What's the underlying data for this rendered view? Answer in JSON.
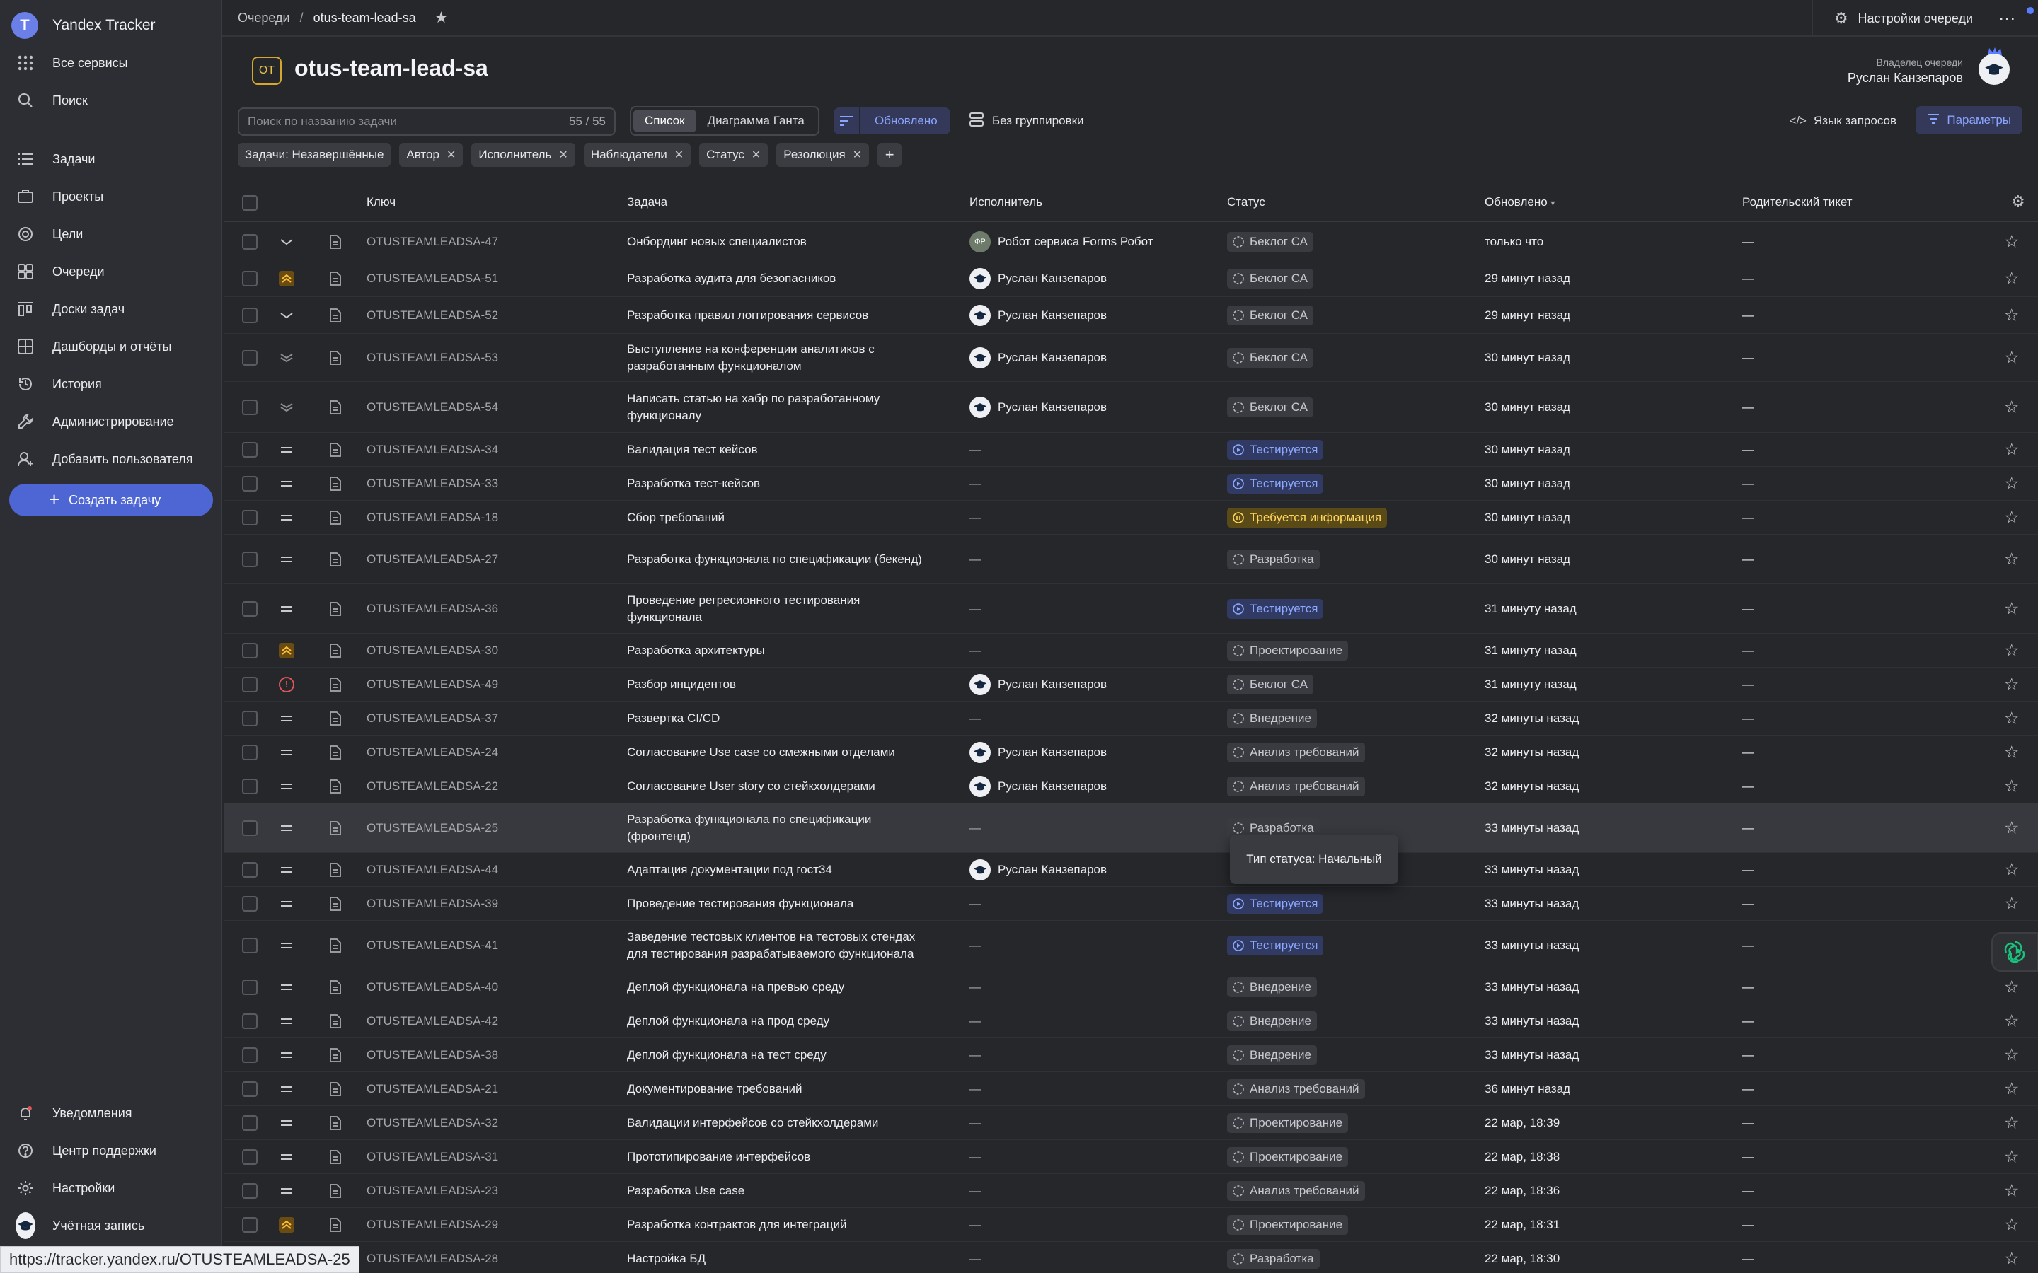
{
  "app": {
    "name": "Yandex Tracker",
    "logo_letter": "T"
  },
  "sidebar": {
    "top_items": [
      {
        "label": "Все сервисы",
        "icon": "grid-icon"
      },
      {
        "label": "Поиск",
        "icon": "search-icon"
      }
    ],
    "items": [
      {
        "label": "Задачи",
        "icon": "tasks-icon"
      },
      {
        "label": "Проекты",
        "icon": "projects-icon"
      },
      {
        "label": "Цели",
        "icon": "goals-icon"
      },
      {
        "label": "Очереди",
        "icon": "queues-icon"
      },
      {
        "label": "Доски задач",
        "icon": "boards-icon"
      },
      {
        "label": "Дашборды и отчёты",
        "icon": "dashboards-icon"
      },
      {
        "label": "История",
        "icon": "history-icon"
      },
      {
        "label": "Администрирование",
        "icon": "admin-icon"
      },
      {
        "label": "Добавить пользователя",
        "icon": "add-user-icon"
      }
    ],
    "create_label": "Создать задачу",
    "bottom_items": [
      {
        "label": "Уведомления",
        "icon": "bell-icon"
      },
      {
        "label": "Центр поддержки",
        "icon": "help-icon"
      },
      {
        "label": "Настройки",
        "icon": "gear-icon"
      },
      {
        "label": "Учётная запись",
        "icon": "account-avatar"
      }
    ]
  },
  "topbar": {
    "breadcrumb_root": "Очереди",
    "breadcrumb_sep": "/",
    "breadcrumb_current": "otus-team-lead-sa",
    "queue_settings_label": "Настройки очереди",
    "more_label": "⋯"
  },
  "header": {
    "badge": "OT",
    "title": "otus-team-lead-sa",
    "owner_caption": "Владелец очереди",
    "owner_name": "Руслан Канзепаров"
  },
  "toolbar": {
    "search_placeholder": "Поиск по названию задачи",
    "search_count": "55 / 55",
    "view_list": "Список",
    "view_gantt": "Диаграмма Ганта",
    "sort_label": "Обновлено",
    "group_label": "Без группировки",
    "query_label": "Язык запросов",
    "params_label": "Параметры"
  },
  "filters": [
    "Задачи: Незавершённые",
    "Автор",
    "Исполнитель",
    "Наблюдатели",
    "Статус",
    "Резолюция"
  ],
  "filters_closable": [
    false,
    true,
    true,
    true,
    true,
    true
  ],
  "table": {
    "headers": {
      "key": "Ключ",
      "task": "Задача",
      "assignee": "Исполнитель",
      "status": "Статус",
      "updated": "Обновлено",
      "parent": "Родительский тикет"
    },
    "rows": [
      {
        "prio": "low",
        "key": "OTUSTEAMLEADSA-47",
        "task": "Онбординг новых специалистов",
        "assignee": "Робот сервиса Forms Робот",
        "avatar": "robot",
        "status": "Беклог СА",
        "st": "gray",
        "updated": "только что",
        "parent": "—",
        "h": 52
      },
      {
        "prio": "high",
        "key": "OTUSTEAMLEADSA-51",
        "task": "Разработка аудита для безопасников",
        "assignee": "Руслан Канзепаров",
        "avatar": "cap",
        "status": "Беклог СА",
        "st": "gray",
        "updated": "29 минут назад",
        "parent": "—",
        "h": 52
      },
      {
        "prio": "low",
        "key": "OTUSTEAMLEADSA-52",
        "task": "Разработка правил логгирования сервисов",
        "assignee": "Руслан Канзепаров",
        "avatar": "cap",
        "status": "Беклог СА",
        "st": "gray",
        "updated": "29 минут назад",
        "parent": "—",
        "h": 52
      },
      {
        "prio": "lowest",
        "key": "OTUSTEAMLEADSA-53",
        "task": "Выступление на конференции аналитиков с разработанным функционалом",
        "assignee": "Руслан Канзепаров",
        "avatar": "cap",
        "status": "Беклог СА",
        "st": "gray",
        "updated": "30 минут назад",
        "parent": "—",
        "h": 68
      },
      {
        "prio": "lowest",
        "key": "OTUSTEAMLEADSA-54",
        "task": "Написать статью на хабр по разработанному функционалу",
        "assignee": "Руслан Канзепаров",
        "avatar": "cap",
        "status": "Беклог СА",
        "st": "gray",
        "updated": "30 минут назад",
        "parent": "—",
        "h": 72
      },
      {
        "prio": "normal",
        "key": "OTUSTEAMLEADSA-34",
        "task": "Валидация тест кейсов",
        "assignee": "—",
        "avatar": "",
        "status": "Тестируется",
        "st": "blue",
        "updated": "30 минут назад",
        "parent": "—",
        "h": 48
      },
      {
        "prio": "normal",
        "key": "OTUSTEAMLEADSA-33",
        "task": "Разработка тест-кейсов",
        "assignee": "—",
        "avatar": "",
        "status": "Тестируется",
        "st": "blue",
        "updated": "30 минут назад",
        "parent": "—",
        "h": 48
      },
      {
        "prio": "normal",
        "key": "OTUSTEAMLEADSA-18",
        "task": "Сбор требований",
        "assignee": "—",
        "avatar": "",
        "status": "Требуется информация",
        "st": "yellow",
        "updated": "30 минут назад",
        "parent": "—",
        "h": 48
      },
      {
        "prio": "normal",
        "key": "OTUSTEAMLEADSA-27",
        "task": "Разработка функционала по спецификации (бекенд)",
        "assignee": "—",
        "avatar": "",
        "status": "Разработка",
        "st": "gray",
        "updated": "30 минут назад",
        "parent": "—",
        "h": 70
      },
      {
        "prio": "normal",
        "key": "OTUSTEAMLEADSA-36",
        "task": "Проведение регресионного тестирования функционала",
        "assignee": "—",
        "avatar": "",
        "status": "Тестируется",
        "st": "blue",
        "updated": "31 минуту назад",
        "parent": "—",
        "h": 70
      },
      {
        "prio": "high",
        "key": "OTUSTEAMLEADSA-30",
        "task": "Разработка архитектуры",
        "assignee": "—",
        "avatar": "",
        "status": "Проектирование",
        "st": "gray",
        "updated": "31 минуту назад",
        "parent": "—",
        "h": 48
      },
      {
        "prio": "critical",
        "key": "OTUSTEAMLEADSA-49",
        "task": "Разбор инцидентов",
        "assignee": "Руслан Канзепаров",
        "avatar": "cap",
        "status": "Беклог СА",
        "st": "gray",
        "updated": "31 минуту назад",
        "parent": "—",
        "h": 48
      },
      {
        "prio": "normal",
        "key": "OTUSTEAMLEADSA-37",
        "task": "Развертка CI/CD",
        "assignee": "—",
        "avatar": "",
        "status": "Внедрение",
        "st": "gray",
        "updated": "32 минуты назад",
        "parent": "—",
        "h": 48
      },
      {
        "prio": "normal",
        "key": "OTUSTEAMLEADSA-24",
        "task": "Согласование Use case со смежными отделами",
        "assignee": "Руслан Канзепаров",
        "avatar": "cap",
        "status": "Анализ требований",
        "st": "gray",
        "updated": "32 минуты назад",
        "parent": "—",
        "h": 48
      },
      {
        "prio": "normal",
        "key": "OTUSTEAMLEADSA-22",
        "task": "Согласование User story со стейкхолдерами",
        "assignee": "Руслан Канзепаров",
        "avatar": "cap",
        "status": "Анализ требований",
        "st": "gray",
        "updated": "32 минуты назад",
        "parent": "—",
        "h": 48
      },
      {
        "prio": "normal",
        "key": "OTUSTEAMLEADSA-25",
        "task": "Разработка функционала по спецификации (фронтенд)",
        "assignee": "—",
        "avatar": "",
        "status": "Разработка",
        "st": "gray",
        "updated": "33 минуты назад",
        "parent": "—",
        "h": 70,
        "hl": true
      },
      {
        "prio": "normal",
        "key": "OTUSTEAMLEADSA-44",
        "task": "Адаптация документации под гост34",
        "assignee": "Руслан Канзепаров",
        "avatar": "cap",
        "status": "",
        "st": "gray",
        "updated": "33 минуты назад",
        "parent": "—",
        "h": 48
      },
      {
        "prio": "normal",
        "key": "OTUSTEAMLEADSA-39",
        "task": "Проведение тестирования функционала",
        "assignee": "—",
        "avatar": "",
        "status": "Тестируется",
        "st": "blue",
        "updated": "33 минуты назад",
        "parent": "—",
        "h": 48
      },
      {
        "prio": "normal",
        "key": "OTUSTEAMLEADSA-41",
        "task": "Заведение тестовых клиентов на тестовых стендах для тестирования разрабатываемого функционала",
        "assignee": "—",
        "avatar": "",
        "status": "Тестируется",
        "st": "blue",
        "updated": "33 минуты назад",
        "parent": "—",
        "h": 70
      },
      {
        "prio": "normal",
        "key": "OTUSTEAMLEADSA-40",
        "task": "Деплой функционала на превью среду",
        "assignee": "—",
        "avatar": "",
        "status": "Внедрение",
        "st": "gray",
        "updated": "33 минуты назад",
        "parent": "—",
        "h": 48
      },
      {
        "prio": "normal",
        "key": "OTUSTEAMLEADSA-42",
        "task": "Деплой функционала на прод среду",
        "assignee": "—",
        "avatar": "",
        "status": "Внедрение",
        "st": "gray",
        "updated": "33 минуты назад",
        "parent": "—",
        "h": 48
      },
      {
        "prio": "normal",
        "key": "OTUSTEAMLEADSA-38",
        "task": "Деплой функционала на тест среду",
        "assignee": "—",
        "avatar": "",
        "status": "Внедрение",
        "st": "gray",
        "updated": "33 минуты назад",
        "parent": "—",
        "h": 48
      },
      {
        "prio": "normal",
        "key": "OTUSTEAMLEADSA-21",
        "task": "Документирование требований",
        "assignee": "—",
        "avatar": "",
        "status": "Анализ требований",
        "st": "gray",
        "updated": "36 минут назад",
        "parent": "—",
        "h": 48
      },
      {
        "prio": "normal",
        "key": "OTUSTEAMLEADSA-32",
        "task": "Валидации интерфейсов со стейкхолдерами",
        "assignee": "—",
        "avatar": "",
        "status": "Проектирование",
        "st": "gray",
        "updated": "22 мар, 18:39",
        "parent": "—",
        "h": 48
      },
      {
        "prio": "normal",
        "key": "OTUSTEAMLEADSA-31",
        "task": "Прототипирование интерфейсов",
        "assignee": "—",
        "avatar": "",
        "status": "Проектирование",
        "st": "gray",
        "updated": "22 мар, 18:38",
        "parent": "—",
        "h": 48
      },
      {
        "prio": "normal",
        "key": "OTUSTEAMLEADSA-23",
        "task": "Разработка Use case",
        "assignee": "—",
        "avatar": "",
        "status": "Анализ требований",
        "st": "gray",
        "updated": "22 мар, 18:36",
        "parent": "—",
        "h": 48
      },
      {
        "prio": "high",
        "key": "OTUSTEAMLEADSA-29",
        "task": "Разработка контрактов для интеграций",
        "assignee": "—",
        "avatar": "",
        "status": "Проектирование",
        "st": "gray",
        "updated": "22 мар, 18:31",
        "parent": "—",
        "h": 48
      },
      {
        "prio": "normal",
        "key": "OTUSTEAMLEADSA-28",
        "task": "Настройка БД",
        "assignee": "—",
        "avatar": "",
        "status": "Разработка",
        "st": "gray",
        "updated": "22 мар, 18:30",
        "parent": "—",
        "h": 48
      }
    ]
  },
  "tooltip": {
    "text": "Тип статуса: Начальный"
  },
  "status_bar": {
    "url": "https://tracker.yandex.ru/OTUSTEAMLEADSA-25"
  },
  "colors": {
    "accent": "#4e66d4",
    "status_blue": "#8ca8ff",
    "status_yellow": "#ffd65a",
    "critical": "#e05555"
  }
}
